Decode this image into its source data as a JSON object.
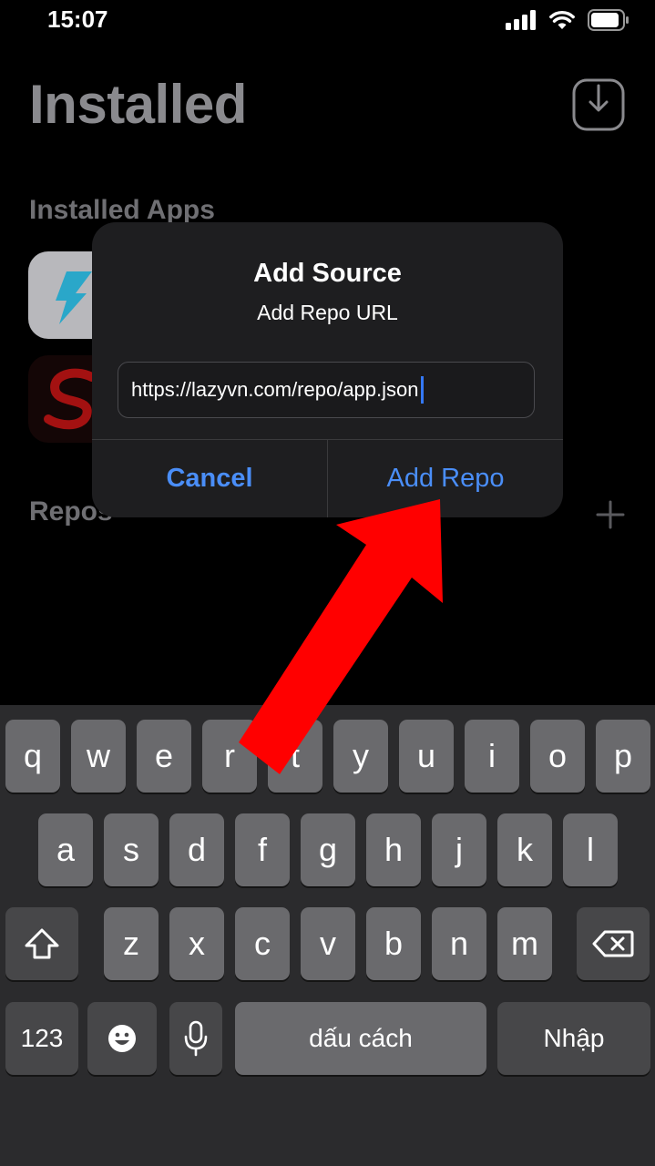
{
  "status": {
    "time": "15:07"
  },
  "page": {
    "title": "Installed",
    "section_installed": "Installed Apps",
    "section_repos": "Repos"
  },
  "alert": {
    "title": "Add Source",
    "message": "Add Repo URL",
    "input_value": "https://lazyvn.com/repo/app.json",
    "cancel_label": "Cancel",
    "add_label": "Add Repo"
  },
  "keyboard": {
    "row1": [
      "q",
      "w",
      "e",
      "r",
      "t",
      "y",
      "u",
      "i",
      "o",
      "p"
    ],
    "row2": [
      "a",
      "s",
      "d",
      "f",
      "g",
      "h",
      "j",
      "k",
      "l"
    ],
    "row3": [
      "z",
      "x",
      "c",
      "v",
      "b",
      "n",
      "m"
    ],
    "numbers_label": "123",
    "space_label": "dấu cách",
    "return_label": "Nhập"
  },
  "colors": {
    "accent": "#4a8ef8",
    "annotation_arrow": "#ff0000"
  }
}
